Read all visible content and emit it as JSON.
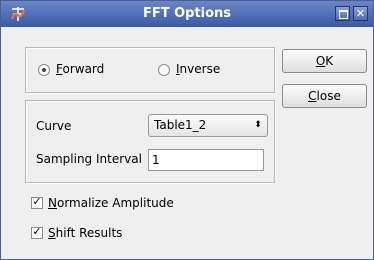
{
  "window": {
    "title": "FFT Options"
  },
  "titlebar": {
    "maximize_glyph": "□",
    "close_glyph": "✕"
  },
  "direction": {
    "forward": {
      "mnemonic": "F",
      "rest": "orward",
      "selected": true
    },
    "inverse": {
      "mnemonic": "I",
      "rest": "nverse",
      "selected": false
    }
  },
  "curve": {
    "label": "Curve",
    "value": "Table1_2",
    "arrow_glyph": "⬍"
  },
  "sampling": {
    "label": "Sampling Interval",
    "value": "1"
  },
  "buttons": {
    "ok": {
      "mnemonic": "O",
      "rest": "K"
    },
    "close": {
      "mnemonic": "C",
      "rest": "lose"
    }
  },
  "options": {
    "normalize": {
      "mnemonic": "N",
      "rest": "ormalize Amplitude",
      "checked": true
    },
    "shift": {
      "mnemonic": "S",
      "rest": "hift Results",
      "checked": true
    },
    "check_glyph": "✓"
  },
  "icons": {
    "app": "fft-app-icon",
    "maximize": "maximize-icon",
    "close": "close-icon"
  },
  "colors": {
    "titlebar": "#4a68b0",
    "dialog_bg": "#efefef"
  }
}
